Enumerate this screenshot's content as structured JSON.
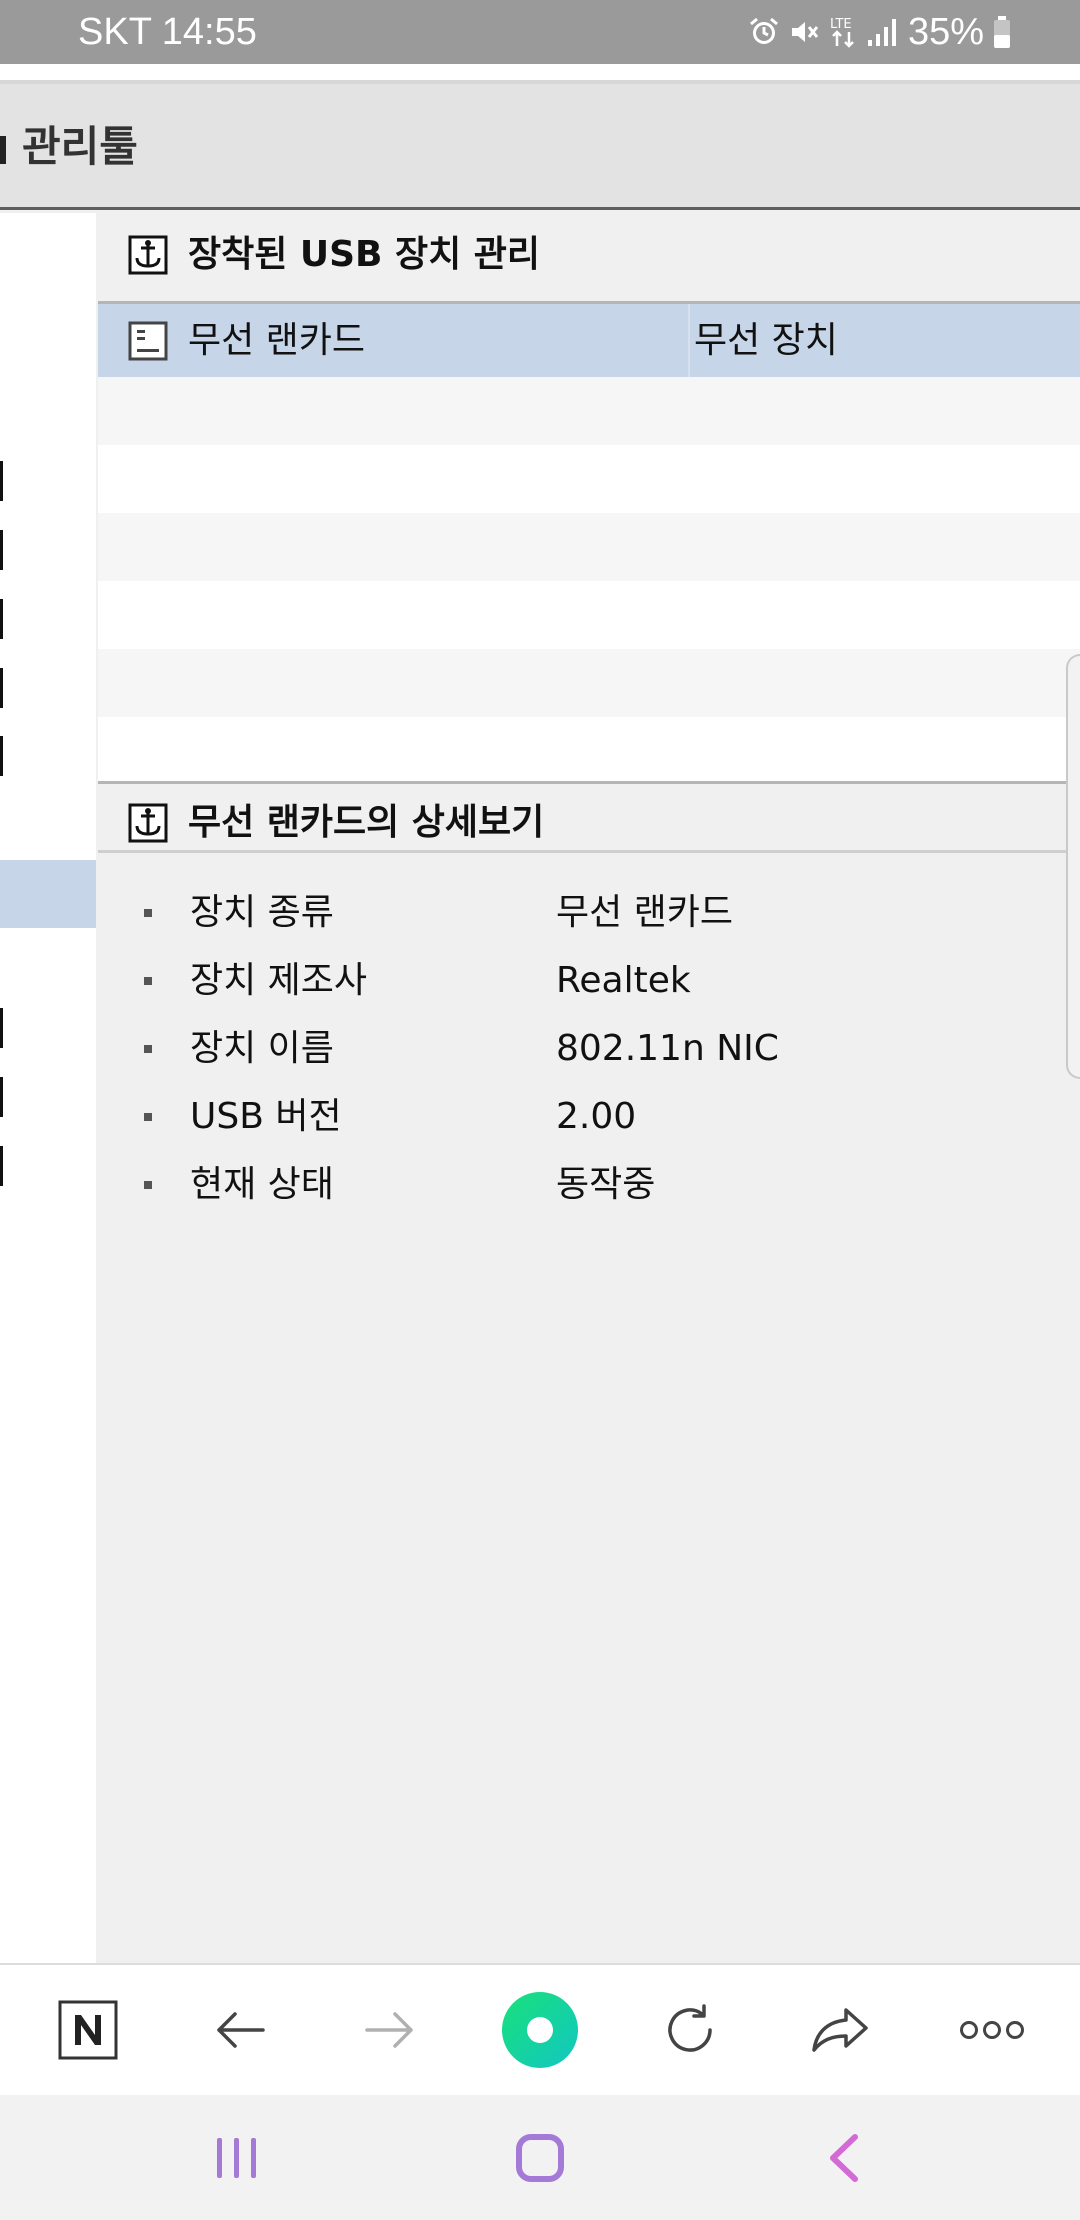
{
  "status_bar": {
    "carrier_time": "SKT 14:55",
    "network": "LTE",
    "battery": "35%",
    "icons": [
      "alarm-icon",
      "mute-icon",
      "lte-icon",
      "signal-icon",
      "battery-icon"
    ]
  },
  "page": {
    "title": "관리툴"
  },
  "usb_section": {
    "title": "장착된 USB 장치 관리",
    "header_row": {
      "name": "무선 랜카드",
      "type": "무선 장치"
    }
  },
  "detail_section": {
    "title": "무선 랜카드의 상세보기",
    "items": [
      {
        "label": "장치 종류",
        "value": "무선 랜카드"
      },
      {
        "label": "장치 제조사",
        "value": "Realtek"
      },
      {
        "label": "장치 이름",
        "value": "802.11n NIC"
      },
      {
        "label": "USB 버전",
        "value": "2.00"
      },
      {
        "label": "현재 상태",
        "value": "동작중"
      }
    ]
  },
  "toolbar": {
    "items": [
      "naver-icon",
      "back-arrow-icon",
      "forward-arrow-icon",
      "green-dot-icon",
      "refresh-icon",
      "share-icon",
      "more-icon"
    ]
  },
  "colors": {
    "selected_row": "#c7d5e9",
    "status_bar": "#9a9a9a",
    "accent_green": "#1fd38a",
    "nav_purple": "#a47ad6"
  }
}
